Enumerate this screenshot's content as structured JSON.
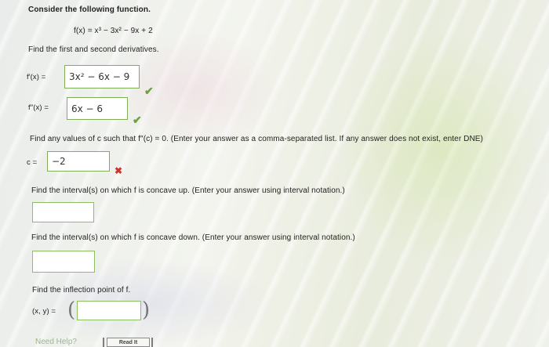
{
  "intro": "Consider the following function.",
  "function_def": "f(x) = x³ − 3x² − 9x + 2",
  "derivs_prompt": "Find the first and second derivatives.",
  "first_deriv": {
    "label": "f′(x) =",
    "value": "3x² − 6x − 9"
  },
  "second_deriv": {
    "label": "f″(x) =",
    "value": "6x − 6"
  },
  "c_prompt": "Find any values of c such that f″(c) = 0. (Enter your answer as a comma-separated list. If any answer does not exist, enter DNE)",
  "c_answer": {
    "label": "c =",
    "value": "−2"
  },
  "concave_up_prompt": "Find the interval(s) on which f is concave up. (Enter your answer using interval notation.)",
  "concave_down_prompt": "Find the interval(s) on which f is concave down. (Enter your answer using interval notation.)",
  "inflection_prompt": "Find the inflection point of f.",
  "inflection_label": "(x, y) =",
  "help": {
    "label": "Need Help?",
    "read_button": "Read It"
  },
  "icons": {
    "correct": "check-icon",
    "incorrect": "x-icon"
  },
  "colors": {
    "correct": "#6d9f3f",
    "incorrect": "#d0342c",
    "box_border": "#7fae58"
  }
}
